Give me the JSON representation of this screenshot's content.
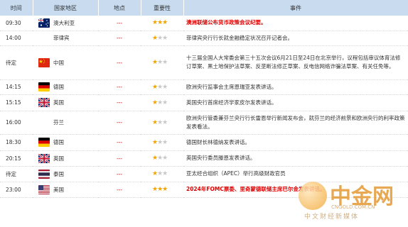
{
  "headers": [
    "时间",
    "国家地区",
    "地点",
    "重要性",
    "事件"
  ],
  "rows": [
    {
      "time": "09:30",
      "country": "澳大利亚",
      "flag": "au",
      "place": "---",
      "stars": 3,
      "event": "澳洲联储公布货币政策会议纪要。",
      "red": true
    },
    {
      "time": "14:00",
      "country": "菲律宾",
      "flag": "",
      "place": "---",
      "stars": 1,
      "event": "菲律宾央行行长就金融稳定状况召开记者会。",
      "red": false
    },
    {
      "time": "待定",
      "country": "中国",
      "flag": "cn",
      "place": "---",
      "stars": 1,
      "event": "十三届全国人大常委会第三十五次会议6月21日至24日在北京举行，议程包括审议体育法修订草案、黑土地保护法草案、反垄断法修正草案、反电信网络诈骗法草案、有关任免等。",
      "red": false
    },
    {
      "time": "14:15",
      "country": "德国",
      "flag": "de",
      "place": "---",
      "stars": 1,
      "event": "欧洲央行监事会主席恩瑞亚发表讲话。",
      "red": false
    },
    {
      "time": "15:15",
      "country": "英国",
      "flag": "gb",
      "place": "---",
      "stars": 1,
      "event": "英国央行首席经济学家皮尔发表讲话。",
      "red": false
    },
    {
      "time": "16:00",
      "country": "芬兰",
      "flag": "",
      "place": "---",
      "stars": 1,
      "event": "欧洲央行管委兼芬兰央行行长雷恩举行新闻发布会，就芬兰的经济前景和欧洲央行的利率政策发表看法。",
      "red": false
    },
    {
      "time": "18:30",
      "country": "德国",
      "flag": "de",
      "place": "---",
      "stars": 1,
      "event": "德国财长林德纳发表讲话。",
      "red": false
    },
    {
      "time": "20:15",
      "country": "英国",
      "flag": "gb",
      "place": "---",
      "stars": 1,
      "event": "英国央行委员滕恩发表讲话。",
      "red": false
    },
    {
      "time": "待定",
      "country": "泰国",
      "flag": "th",
      "place": "---",
      "stars": 1,
      "event": "亚太经合组织（APEC）举行高级财政官员",
      "red": false
    },
    {
      "time": "23:00",
      "country": "美国",
      "flag": "us",
      "place": "---",
      "stars": 3,
      "event": "2024年FOMC票委、里奇蒙德联储主席巴尔金发表讲话。",
      "red": true
    }
  ],
  "watermark": {
    "title": "中金网",
    "url": "CNGOLD.COM.CN",
    "slogan": "中文财经新媒体"
  }
}
